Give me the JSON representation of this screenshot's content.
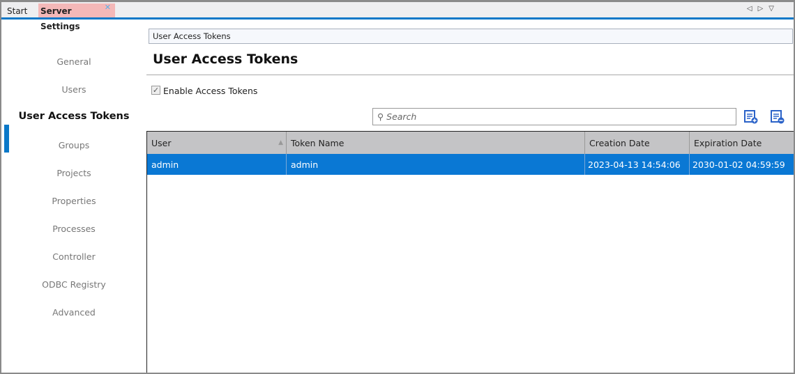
{
  "tabs": {
    "start": "Start",
    "active": "Server Settings"
  },
  "sidebar": {
    "items": [
      {
        "label": "General"
      },
      {
        "label": "Users"
      },
      {
        "label": "User Access Tokens"
      },
      {
        "label": "Groups"
      },
      {
        "label": "Projects"
      },
      {
        "label": "Properties"
      },
      {
        "label": "Processes"
      },
      {
        "label": "Controller"
      },
      {
        "label": "ODBC Registry"
      },
      {
        "label": "Advanced"
      }
    ],
    "active_index": 2
  },
  "main": {
    "breadcrumb": "User Access Tokens",
    "title": "User Access Tokens",
    "enable_label": "Enable Access Tokens",
    "enable_checked": true,
    "search_placeholder": "Search"
  },
  "table": {
    "columns": [
      "User",
      "Token Name",
      "Creation Date",
      "Expiration Date"
    ],
    "sort_column": "User",
    "rows": [
      {
        "user": "admin",
        "token": "admin",
        "created": "2023-04-13 14:54:06",
        "expires": "2030-01-02 04:59:59",
        "selected": true
      }
    ]
  },
  "colors": {
    "accent": "#0a78c8",
    "selection": "#0a78d4",
    "active_tab": "#f4b8b8"
  }
}
